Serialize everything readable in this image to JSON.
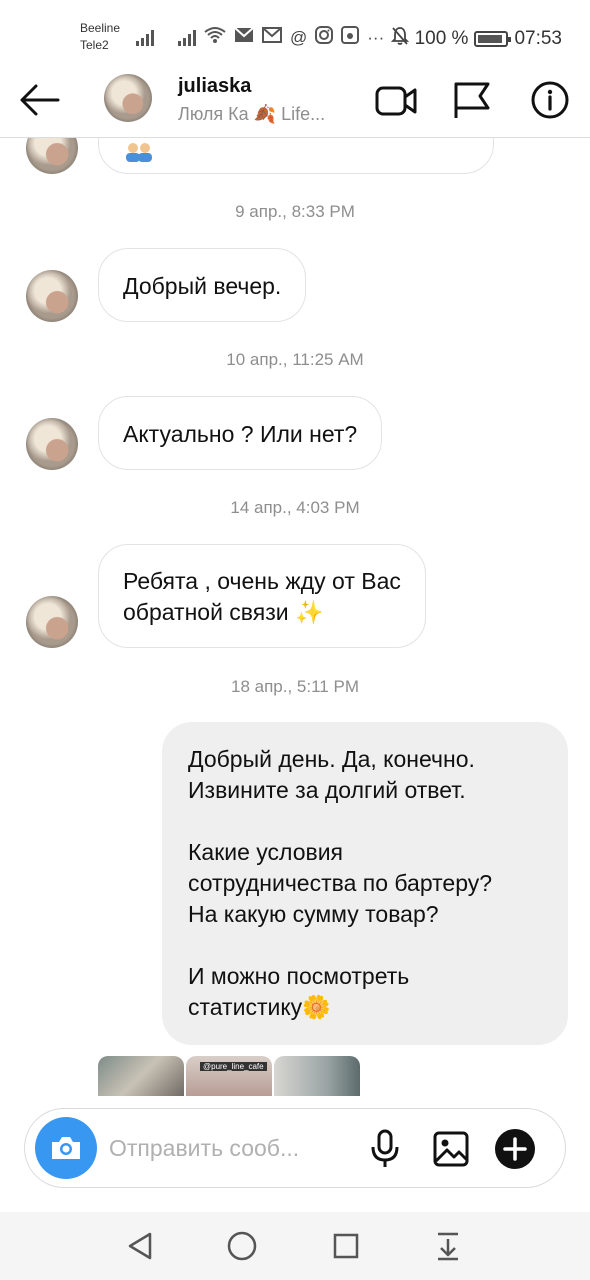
{
  "status_bar": {
    "carrier_1": "Beeline",
    "carrier_2": "Tele2",
    "battery": "100 %",
    "time": "07:53"
  },
  "header": {
    "username": "juliaska",
    "subtitle": "Люля Ка 🍂 Life..."
  },
  "messages": [
    {
      "timestamp": "9 апр., 8:33 PM",
      "text": "Добрый вечер."
    },
    {
      "timestamp": "10 апр., 11:25 AM",
      "text": "Актуально ? Или нет?"
    },
    {
      "timestamp": "14 апр., 4:03 PM",
      "line1": "Ребята , очень жду от Вас",
      "line2": "обратной связи ✨"
    }
  ],
  "outgoing": {
    "timestamp": "18 апр., 5:11 PM",
    "paragraph1_line1": "Добрый день. Да, конечно.",
    "paragraph1_line2": "Извините за долгий ответ.",
    "paragraph2_line1": "Какие условия",
    "paragraph2_line2": "сотрудничества по бартеру?",
    "paragraph2_line3": "На какую сумму товар?",
    "paragraph3_line1": "И можно посмотреть",
    "paragraph3_line2": "статистику🌼"
  },
  "shared_post_tag": "@pure_line_cafe",
  "composer": {
    "placeholder": "Отправить сооб..."
  },
  "colors": {
    "accent": "#3897f0",
    "outgoing_bubble": "#efefef",
    "muted_text": "#8e8e8e"
  }
}
